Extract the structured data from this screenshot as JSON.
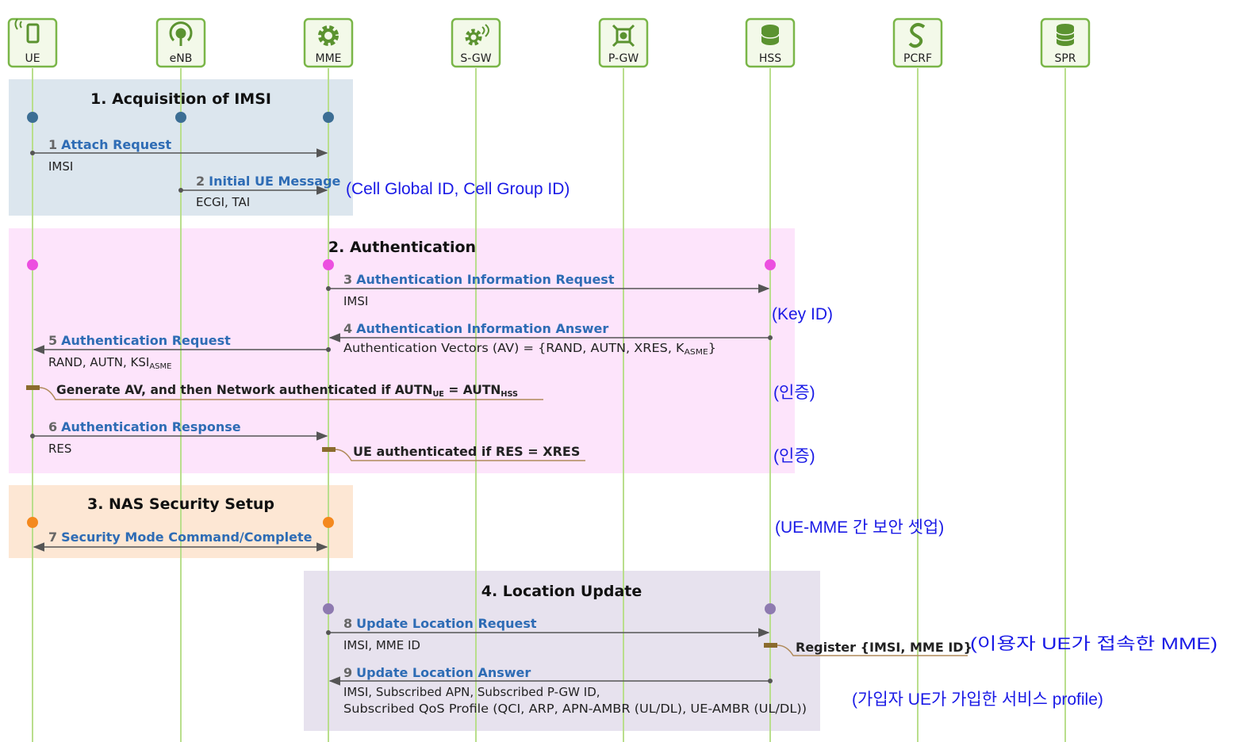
{
  "entities": [
    {
      "id": "ue",
      "label": "UE",
      "icon": "mobile-phone-icon"
    },
    {
      "id": "enb",
      "label": "eNB",
      "icon": "antenna-icon"
    },
    {
      "id": "mme",
      "label": "MME",
      "icon": "gear-icon"
    },
    {
      "id": "sgw",
      "label": "S-GW",
      "icon": "gear-wireless-icon"
    },
    {
      "id": "pgw",
      "label": "P-GW",
      "icon": "gateway-icon"
    },
    {
      "id": "hss",
      "label": "HSS",
      "icon": "database-icon"
    },
    {
      "id": "pcrf",
      "label": "PCRF",
      "icon": "policy-icon"
    },
    {
      "id": "spr",
      "label": "SPR",
      "icon": "database-stack-icon"
    }
  ],
  "phases": [
    {
      "title": "1. Acquisition of IMSI",
      "color": "#dce6ee",
      "dot_color": "#3c6e94"
    },
    {
      "title": "2. Authentication",
      "color": "#fde4fb",
      "dot_color": "#ec4fe0"
    },
    {
      "title": "3. NAS Security Setup",
      "color": "#fde7d4",
      "dot_color": "#f4891e"
    },
    {
      "title": "4. Location Update",
      "color": "#e7e2ee",
      "dot_color": "#8e7ab0"
    }
  ],
  "messages": [
    {
      "num": "1",
      "label": "Attach Request",
      "params": [
        "IMSI"
      ]
    },
    {
      "num": "2",
      "label": "Initial UE Message",
      "params": [
        "ECGI, TAI"
      ]
    },
    {
      "num": "3",
      "label": "Authentication Information Request",
      "params": [
        "IMSI"
      ]
    },
    {
      "num": "4",
      "label": "Authentication Information Answer",
      "params": [
        "Authentication Vectors (AV) = {RAND, AUTN, XRES, K"
      ],
      "param_sub": "ASME",
      "param_after": "}"
    },
    {
      "num": "5",
      "label": "Authentication Request",
      "params": [
        "RAND, AUTN, KSI"
      ],
      "param_sub": "ASME"
    },
    {
      "num": "6",
      "label": "Authentication Response",
      "params": [
        "RES"
      ]
    },
    {
      "num": "7",
      "label": "Security Mode Command/Complete",
      "params": []
    },
    {
      "num": "8",
      "label": "Update Location Request",
      "params": [
        "IMSI, MME ID"
      ]
    },
    {
      "num": "9",
      "label": "Update Location Answer",
      "params": [
        "IMSI, Subscribed APN, Subscribed P-GW ID,",
        "Subscribed QoS Profile (QCI, ARP, APN-AMBR (UL/DL), UE-AMBR (UL/DL))"
      ]
    }
  ],
  "processes": [
    {
      "pre": "Generate AV, and then Network authenticated if AUTN",
      "sub1": "UE",
      "mid": " = AUTN",
      "sub2": "HSS"
    },
    {
      "pre": "UE authenticated if RES = XRES"
    },
    {
      "pre": "Register {IMSI, MME ID}"
    }
  ],
  "notes": [
    "(Cell Global ID, Cell Group ID)",
    "(Key ID)",
    "(인증)",
    "(인증)",
    "(UE-MME 간 보안 셋업)",
    "(이용자 UE가 접속한 MME)",
    "(가입자 UE가 가입한 서비스 profile)"
  ],
  "colors": {
    "lifeline": "#b9de8c",
    "entity_border": "#7ab648",
    "entity_fill": "#f3f9e9",
    "icon": "#5b9330",
    "arrow": "#555555",
    "message": "#2e6cb5",
    "note": "#1a1ae6",
    "process_marker": "#8b6b2e"
  }
}
